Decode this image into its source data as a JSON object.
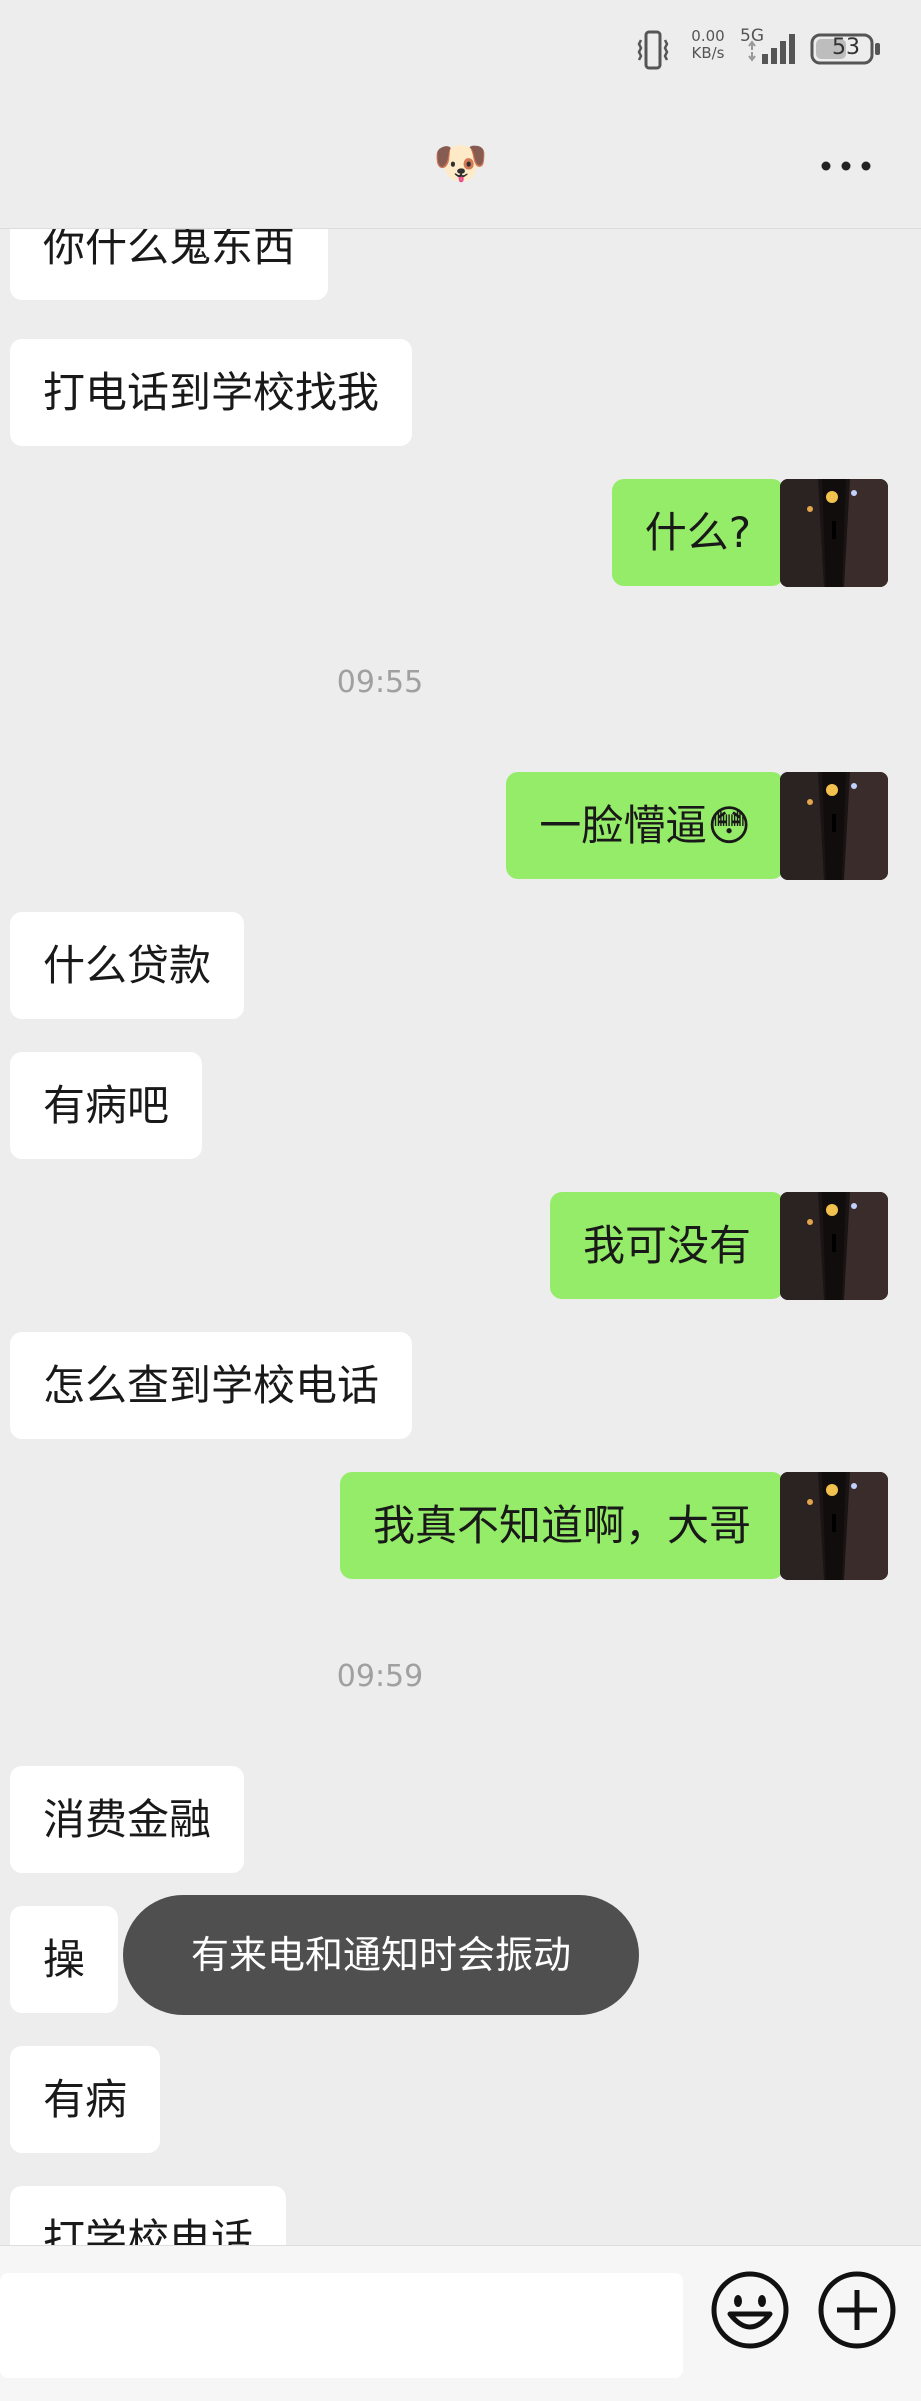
{
  "status_bar": {
    "net_speed_value": "0.00",
    "net_speed_unit": "KB/s",
    "network_type": "5G",
    "battery_level": "53"
  },
  "header": {
    "contact_avatar_emoji": "🐶"
  },
  "messages": [
    {
      "side": "in",
      "text": "你什么鬼东西"
    },
    {
      "side": "in",
      "text": "打电话到学校找我"
    },
    {
      "side": "out",
      "text": "什么?"
    },
    {
      "time": "09:55"
    },
    {
      "side": "out",
      "text": "一脸懵逼😳"
    },
    {
      "side": "in",
      "text": "什么贷款"
    },
    {
      "side": "in",
      "text": "有病吧"
    },
    {
      "side": "out",
      "text": "我可没有"
    },
    {
      "side": "in",
      "text": "怎么查到学校电话"
    },
    {
      "side": "out",
      "text": "我真不知道啊，大哥"
    },
    {
      "time": "09:59"
    },
    {
      "side": "in",
      "text": "消费金融"
    },
    {
      "side": "in",
      "text": "操"
    },
    {
      "side": "in",
      "text": "有病"
    },
    {
      "side": "in",
      "text": "打学校电话"
    }
  ],
  "toast": {
    "text": "有来电和通知时会振动"
  },
  "input": {
    "value": ""
  },
  "icons": {
    "vibrate": "vibrate-icon",
    "signal": "signal-icon",
    "battery": "battery-icon",
    "more": "more-icon",
    "emoji": "emoji-icon",
    "add": "add-icon"
  },
  "colors": {
    "background": "#ededed",
    "outgoing_bubble": "#95ec69",
    "incoming_bubble": "#ffffff",
    "toast_background": "#4f4f4f"
  }
}
